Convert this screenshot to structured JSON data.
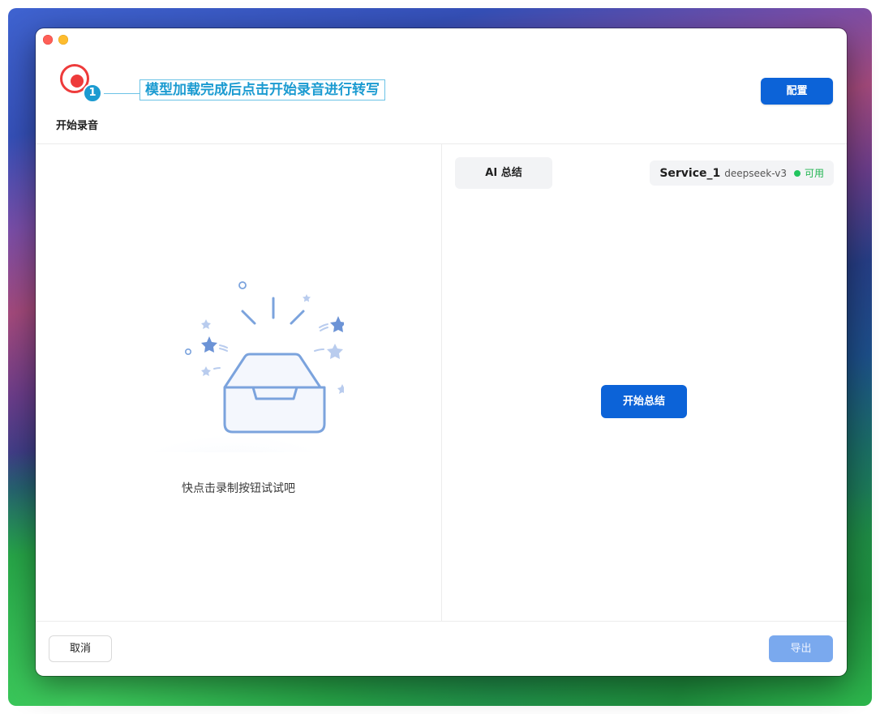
{
  "header": {
    "record_label": "开始录音",
    "step_badge": "1",
    "callout_text": "模型加载完成后点击开始录音进行转写",
    "config_label": "配置"
  },
  "left_pane": {
    "empty_text": "快点击录制按钮试试吧"
  },
  "right_pane": {
    "tab_label": "AI 总结",
    "service_name": "Service_1",
    "service_model": "deepseek-v3",
    "service_status": "可用",
    "summary_button": "开始总结"
  },
  "footer": {
    "cancel_label": "取消",
    "export_label": "导出"
  },
  "colors": {
    "accent": "#0c63d8",
    "record_red": "#ee3b3b",
    "callout_blue": "#1b9bd1",
    "status_green": "#22c55e",
    "export_disabled": "#7aa9ee"
  },
  "icons": {
    "record": "record-icon",
    "empty_state": "empty-inbox-icon"
  }
}
